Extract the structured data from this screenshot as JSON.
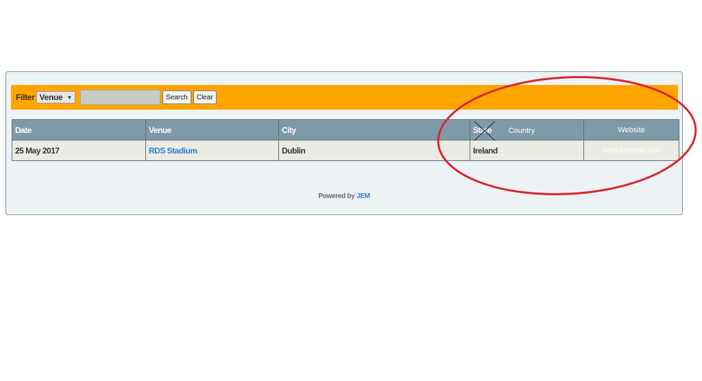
{
  "filter": {
    "label": "Filter",
    "select_value": "Venue",
    "input_value": "",
    "search_label": "Search",
    "clear_label": "Clear"
  },
  "table": {
    "headers": {
      "date": "Date",
      "venue": "Venue",
      "city": "City",
      "state": "State",
      "country_annotation": "Country",
      "website": "Website"
    },
    "rows": [
      {
        "date": "25 May 2017",
        "venue": "RDS Stadium",
        "city": "Dublin",
        "state": "Ireland",
        "website": "www.example.com"
      }
    ]
  },
  "footer": {
    "powered_prefix": "Powered by",
    "powered_link": "JEM"
  },
  "colors": {
    "filter_bar": "#ffa500",
    "header_bg": "#7e9aa8",
    "row_bg": "#ebebe3",
    "link": "#2b7bd6",
    "annotation": "#d9262f"
  },
  "icons": {
    "select_caret": "caret-down-icon",
    "strike_cross": "cross-out-mark"
  }
}
